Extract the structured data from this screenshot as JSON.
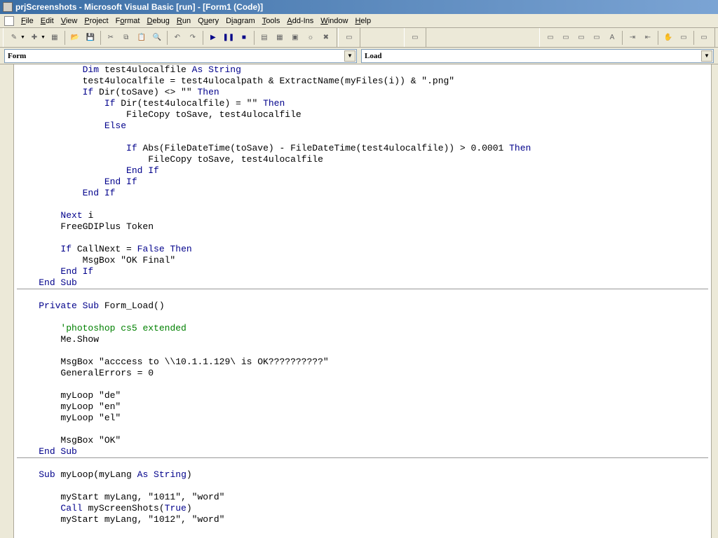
{
  "titlebar": {
    "text": "prjScreenshots - Microsoft Visual Basic [run] - [Form1 (Code)]"
  },
  "menu": {
    "file": "File",
    "edit": "Edit",
    "view": "View",
    "project": "Project",
    "format": "Format",
    "debug": "Debug",
    "run": "Run",
    "query": "Query",
    "diagram": "Diagram",
    "tools": "Tools",
    "addins": "Add-Ins",
    "window": "Window",
    "help": "Help"
  },
  "dropdowns": {
    "object": "Form",
    "proc": "Load"
  },
  "code": {
    "block1_lines": [
      {
        "indent": 8,
        "tokens": [
          {
            "t": "Dim ",
            "c": "kw"
          },
          {
            "t": "test4ulocalfile "
          },
          {
            "t": "As String",
            "c": "kw"
          }
        ]
      },
      {
        "indent": 8,
        "tokens": [
          {
            "t": "test4ulocalfile = test4ulocalpath & ExtractName(myFiles(i)) & \".png\""
          }
        ]
      },
      {
        "indent": 8,
        "tokens": [
          {
            "t": "If ",
            "c": "kw"
          },
          {
            "t": "Dir(toSave) <> \"\" "
          },
          {
            "t": "Then",
            "c": "kw"
          }
        ]
      },
      {
        "indent": 12,
        "tokens": [
          {
            "t": "If ",
            "c": "kw"
          },
          {
            "t": "Dir(test4ulocalfile) = \"\" "
          },
          {
            "t": "Then",
            "c": "kw"
          }
        ]
      },
      {
        "indent": 16,
        "tokens": [
          {
            "t": "FileCopy toSave, test4ulocalfile"
          }
        ]
      },
      {
        "indent": 12,
        "tokens": [
          {
            "t": "Else",
            "c": "kw"
          }
        ]
      },
      {
        "indent": 12,
        "tokens": [
          {
            "t": " "
          }
        ]
      },
      {
        "indent": 16,
        "tokens": [
          {
            "t": "If ",
            "c": "kw"
          },
          {
            "t": "Abs(FileDateTime(toSave) - FileDateTime(test4ulocalfile)) > 0.0001 "
          },
          {
            "t": "Then",
            "c": "kw"
          }
        ]
      },
      {
        "indent": 20,
        "tokens": [
          {
            "t": "FileCopy toSave, test4ulocalfile"
          }
        ]
      },
      {
        "indent": 16,
        "tokens": [
          {
            "t": "End If",
            "c": "kw"
          }
        ]
      },
      {
        "indent": 12,
        "tokens": [
          {
            "t": "End If",
            "c": "kw"
          }
        ]
      },
      {
        "indent": 8,
        "tokens": [
          {
            "t": "End If",
            "c": "kw"
          }
        ]
      },
      {
        "indent": 0,
        "tokens": [
          {
            "t": " "
          }
        ]
      },
      {
        "indent": 4,
        "tokens": [
          {
            "t": "Next ",
            "c": "kw"
          },
          {
            "t": "i"
          }
        ]
      },
      {
        "indent": 4,
        "tokens": [
          {
            "t": "FreeGDIPlus Token"
          }
        ]
      },
      {
        "indent": 0,
        "tokens": [
          {
            "t": " "
          }
        ]
      },
      {
        "indent": 4,
        "tokens": [
          {
            "t": "If ",
            "c": "kw"
          },
          {
            "t": "CallNext = "
          },
          {
            "t": "False Then",
            "c": "kw"
          }
        ]
      },
      {
        "indent": 8,
        "tokens": [
          {
            "t": "MsgBox \"OK Final\""
          }
        ]
      },
      {
        "indent": 4,
        "tokens": [
          {
            "t": "End If",
            "c": "kw"
          }
        ]
      },
      {
        "indent": 0,
        "tokens": [
          {
            "t": "End Sub",
            "c": "kw"
          }
        ]
      }
    ],
    "block2_lines": [
      {
        "indent": 0,
        "tokens": [
          {
            "t": "Private Sub ",
            "c": "kw"
          },
          {
            "t": "Form_Load()"
          }
        ]
      },
      {
        "indent": 0,
        "tokens": [
          {
            "t": " "
          }
        ]
      },
      {
        "indent": 4,
        "tokens": [
          {
            "t": "'photoshop cs5 extended",
            "c": "cm"
          }
        ]
      },
      {
        "indent": 4,
        "tokens": [
          {
            "t": "Me.Show"
          }
        ]
      },
      {
        "indent": 0,
        "tokens": [
          {
            "t": " "
          }
        ]
      },
      {
        "indent": 4,
        "tokens": [
          {
            "t": "MsgBox \"acccess to \\\\10.1.1.129\\ is OK??????????\""
          }
        ]
      },
      {
        "indent": 4,
        "tokens": [
          {
            "t": "GeneralErrors = 0"
          }
        ]
      },
      {
        "indent": 0,
        "tokens": [
          {
            "t": " "
          }
        ]
      },
      {
        "indent": 4,
        "tokens": [
          {
            "t": "myLoop \"de\""
          }
        ]
      },
      {
        "indent": 4,
        "tokens": [
          {
            "t": "myLoop \"en\""
          }
        ]
      },
      {
        "indent": 4,
        "tokens": [
          {
            "t": "myLoop \"el\""
          }
        ]
      },
      {
        "indent": 0,
        "tokens": [
          {
            "t": " "
          }
        ]
      },
      {
        "indent": 4,
        "tokens": [
          {
            "t": "MsgBox \"OK\""
          }
        ]
      },
      {
        "indent": 0,
        "tokens": [
          {
            "t": "End Sub",
            "c": "kw"
          }
        ]
      }
    ],
    "block3_lines": [
      {
        "indent": 0,
        "tokens": [
          {
            "t": "Sub ",
            "c": "kw"
          },
          {
            "t": "myLoop(myLang "
          },
          {
            "t": "As String",
            "c": "kw"
          },
          {
            "t": ")"
          }
        ]
      },
      {
        "indent": 0,
        "tokens": [
          {
            "t": " "
          }
        ]
      },
      {
        "indent": 4,
        "tokens": [
          {
            "t": "myStart myLang, \"1011\", \"word\""
          }
        ]
      },
      {
        "indent": 4,
        "tokens": [
          {
            "t": "Call ",
            "c": "kw"
          },
          {
            "t": "myScreenShots("
          },
          {
            "t": "True",
            "c": "kw"
          },
          {
            "t": ")"
          }
        ]
      },
      {
        "indent": 4,
        "tokens": [
          {
            "t": "myStart myLang, \"1012\", \"word\""
          }
        ]
      }
    ]
  }
}
